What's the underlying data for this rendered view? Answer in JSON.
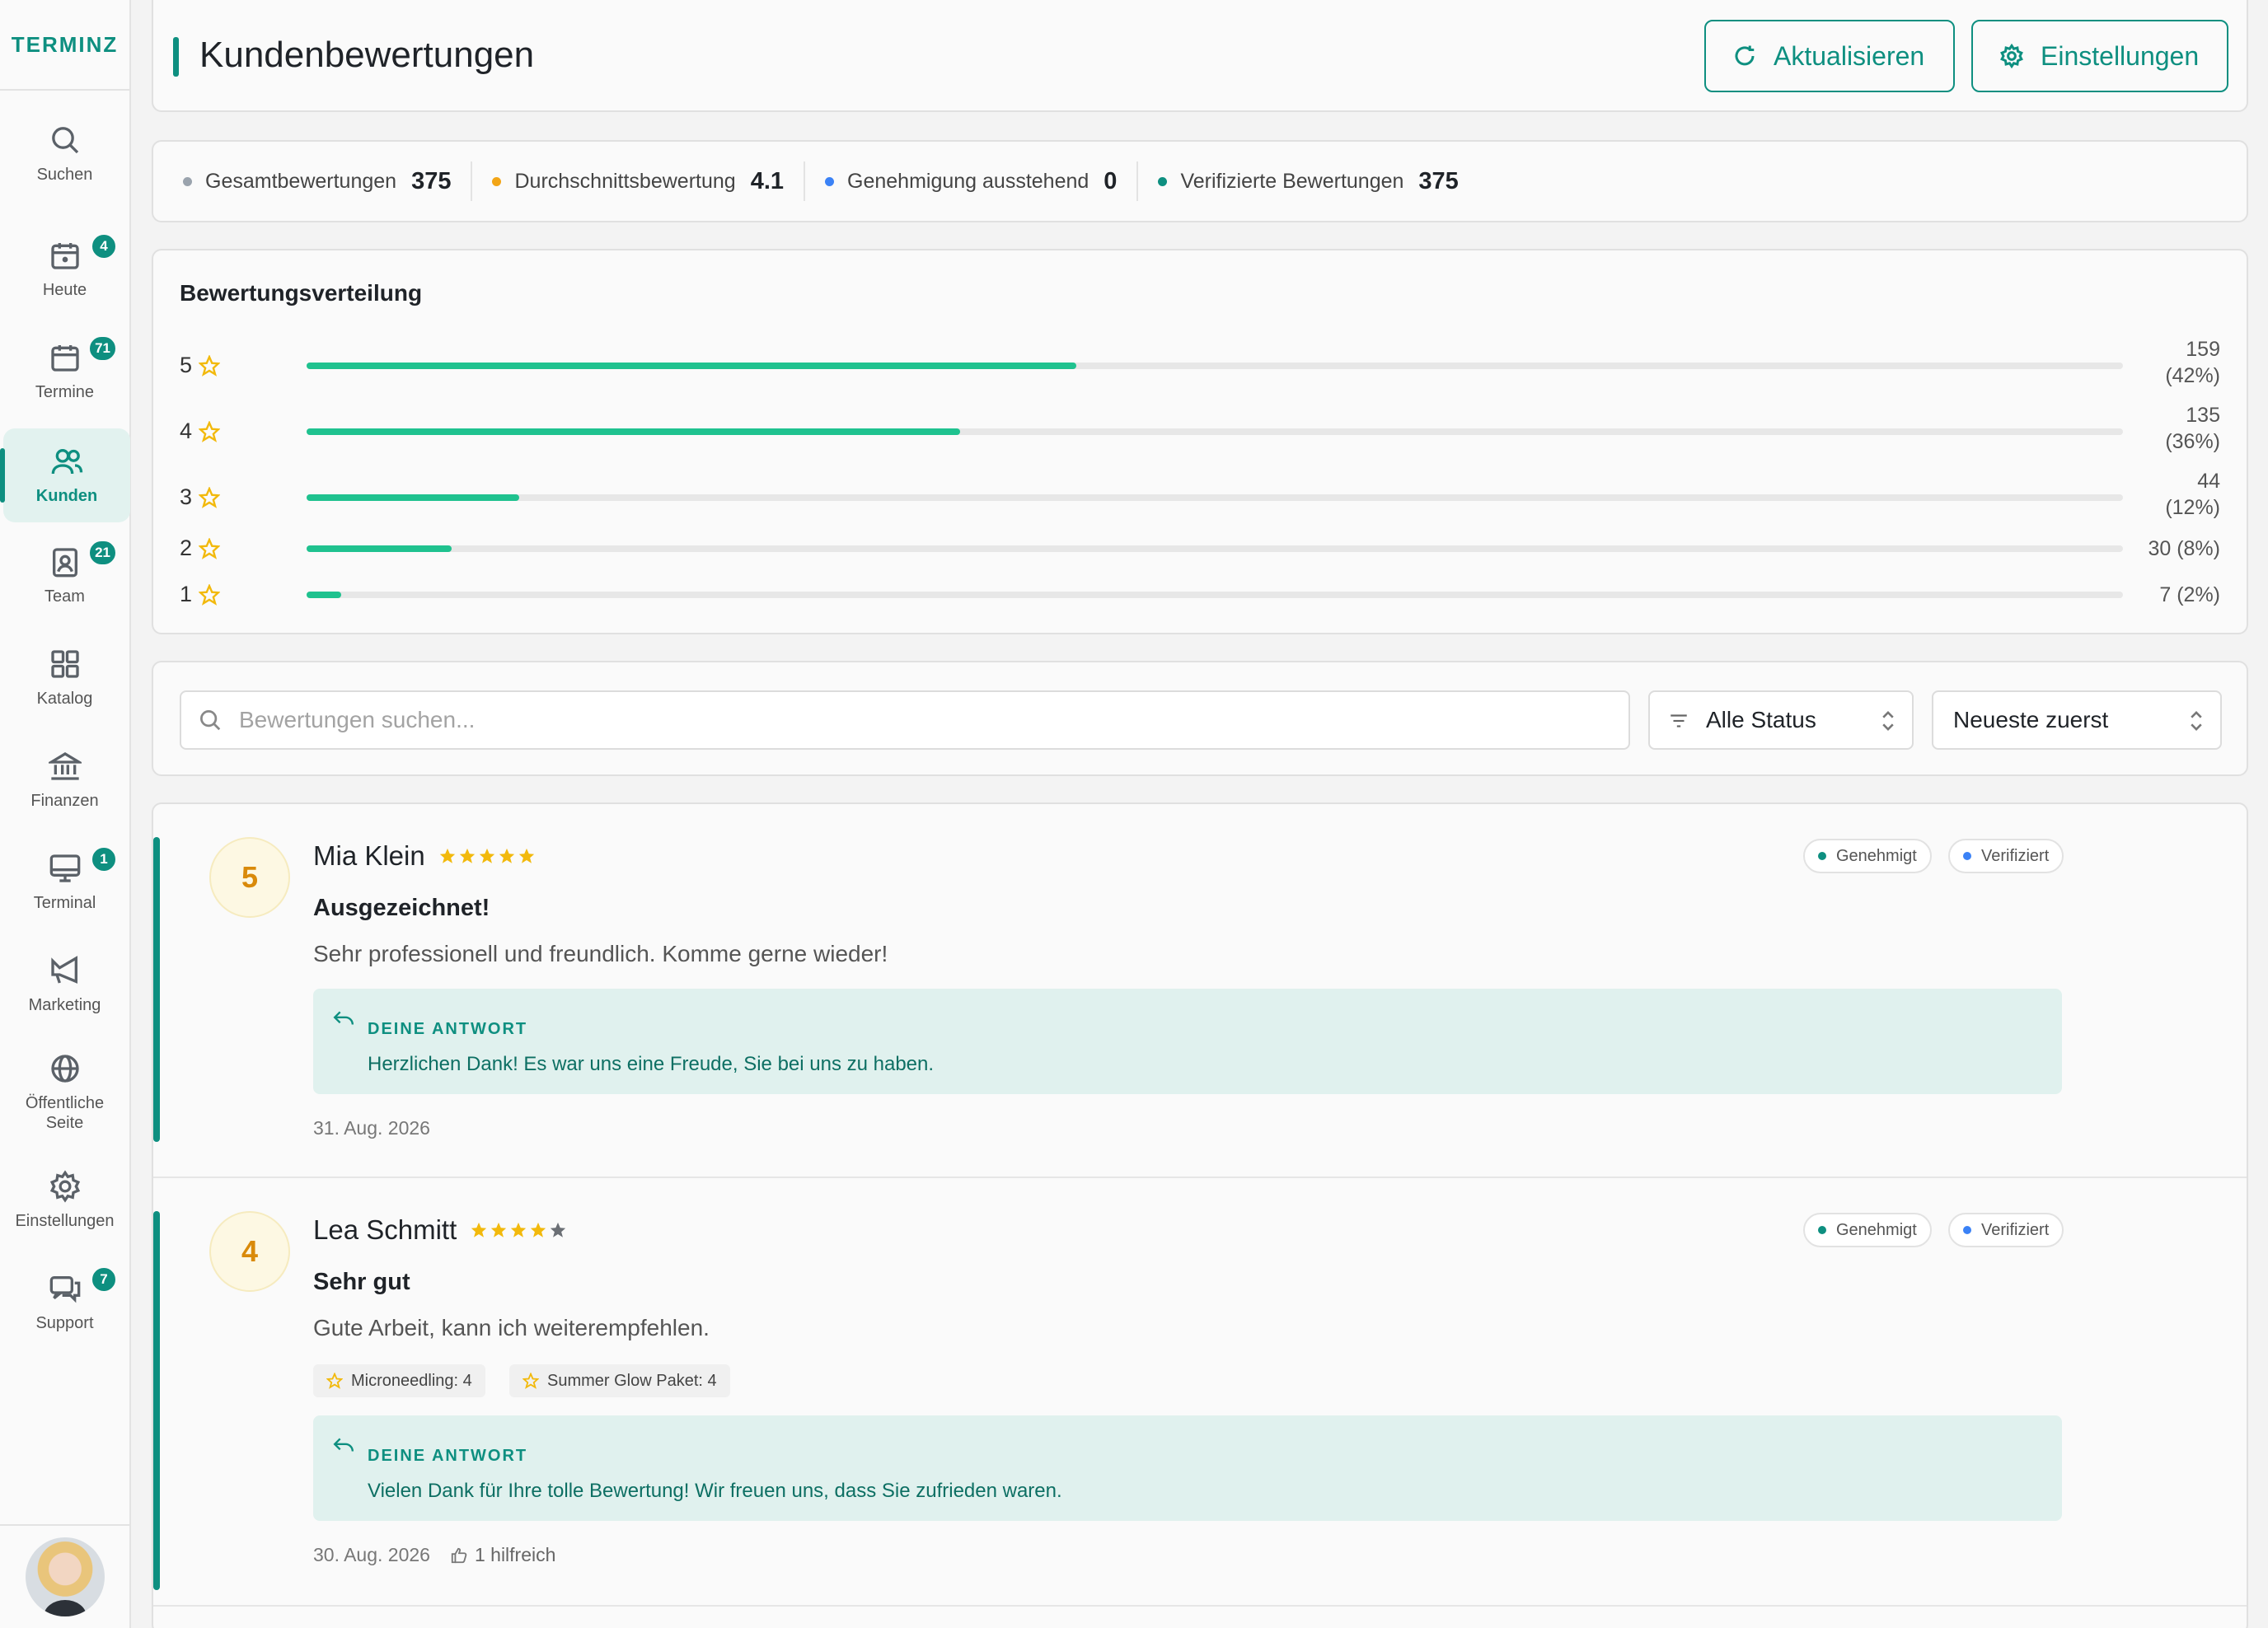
{
  "brand": "TERMINZ",
  "nav": [
    {
      "label": "Suchen",
      "icon": "search-icon"
    },
    {
      "label": "Heute",
      "icon": "calendar-today-icon",
      "badge": "4"
    },
    {
      "label": "Termine",
      "icon": "calendar-icon",
      "badge": "71"
    },
    {
      "label": "Kunden",
      "icon": "users-icon",
      "active": true
    },
    {
      "label": "Team",
      "icon": "id-badge-icon",
      "badge": "21"
    },
    {
      "label": "Katalog",
      "icon": "grid-icon"
    },
    {
      "label": "Finanzen",
      "icon": "bank-icon"
    },
    {
      "label": "Terminal",
      "icon": "monitor-icon",
      "badge": "1"
    },
    {
      "label": "Marketing",
      "icon": "megaphone-icon"
    },
    {
      "label": "Öffentliche\nSeite",
      "icon": "globe-icon"
    },
    {
      "label": "Einstellungen",
      "icon": "gear-icon"
    },
    {
      "label": "Support",
      "icon": "chat-icon",
      "badge": "7"
    }
  ],
  "header": {
    "title": "Kundenbewertungen",
    "refresh_label": "Aktualisieren",
    "settings_label": "Einstellungen"
  },
  "stats": [
    {
      "label": "Gesamtbewertungen",
      "value": "375",
      "color": "#9aa3ad"
    },
    {
      "label": "Durchschnittsbewertung",
      "value": "4.1",
      "color": "#f2a516"
    },
    {
      "label": "Genehmigung ausstehend",
      "value": "0",
      "color": "#3b82f6"
    },
    {
      "label": "Verifizierte Bewertungen",
      "value": "375",
      "color": "#0e8f80"
    }
  ],
  "distribution": {
    "title": "Bewertungsverteilung",
    "rows": [
      {
        "stars": "5",
        "count_line1": "159",
        "count_line2": "(42%)",
        "fraction": 0.424
      },
      {
        "stars": "4",
        "count_line1": "135",
        "count_line2": "(36%)",
        "fraction": 0.36
      },
      {
        "stars": "3",
        "count_line1": "44",
        "count_line2": "(12%)",
        "fraction": 0.117
      },
      {
        "stars": "2",
        "count_line1": "30 (8%)",
        "count_line2": "",
        "fraction": 0.08
      },
      {
        "stars": "1",
        "count_line1": "7 (2%)",
        "count_line2": "",
        "fraction": 0.019
      }
    ]
  },
  "filters": {
    "search_placeholder": "Bewertungen suchen...",
    "status_value": "Alle Status",
    "sort_value": "Neueste zuerst"
  },
  "reviews": [
    {
      "score": "5",
      "rating": 5,
      "name": "Mia Klein",
      "status_badge": "Genehmigt",
      "verified_badge": "Verifiziert",
      "title": "Ausgezeichnet!",
      "text": "Sehr professionell und freundlich. Komme gerne wieder!",
      "tags": [],
      "reply_label": "DEINE ANTWORT",
      "reply_text": "Herzlichen Dank! Es war uns eine Freude, Sie bei uns zu haben.",
      "date": "31. Aug. 2026",
      "helpful": ""
    },
    {
      "score": "4",
      "rating": 4,
      "name": "Lea Schmitt",
      "status_badge": "Genehmigt",
      "verified_badge": "Verifiziert",
      "title": "Sehr gut",
      "text": "Gute Arbeit, kann ich weiterempfehlen.",
      "tags": [
        "Microneedling: 4",
        "Summer Glow Paket: 4"
      ],
      "reply_label": "DEINE ANTWORT",
      "reply_text": "Vielen Dank für Ihre tolle Bewertung! Wir freuen uns, dass Sie zufrieden waren.",
      "date": "30. Aug. 2026",
      "helpful": "1 hilfreich"
    }
  ],
  "colors": {
    "accent": "#0e8f80",
    "bar_fill": "#1fc28f",
    "star": "#f2b90c",
    "approved_dot": "#0e8f80",
    "verified_dot": "#3b82f6"
  }
}
